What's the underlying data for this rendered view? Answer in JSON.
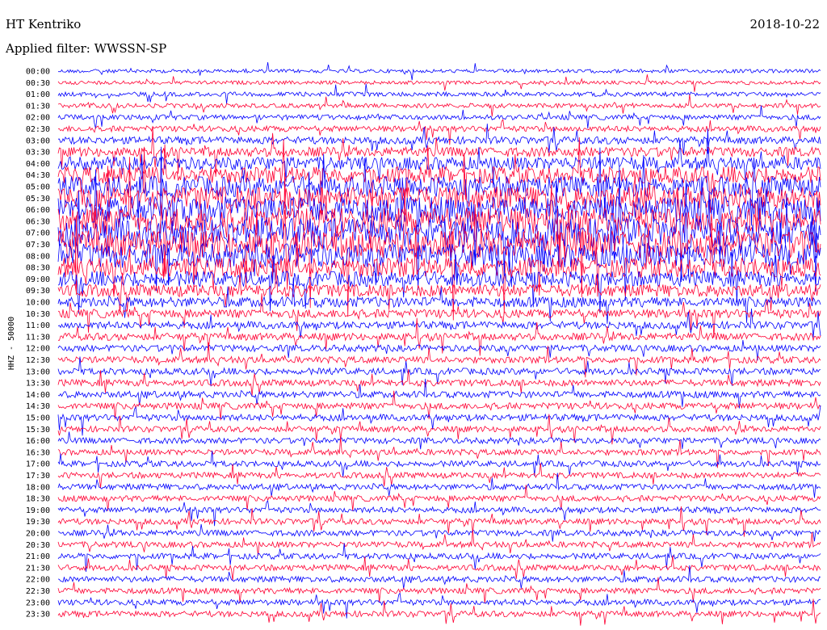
{
  "header": {
    "station": "HT Kentriko",
    "date": "2018-10-22",
    "filter": "Applied filter: WWSSN-SP"
  },
  "chart_data": {
    "type": "line",
    "title": "HT Kentriko",
    "subtitle": "Applied filter: WWSSN-SP",
    "date": "2018-10-22",
    "ylabel": "HHZ - 50000",
    "xlabel": "",
    "row_labels": [
      "00:00",
      "00:30",
      "01:00",
      "01:30",
      "02:00",
      "02:30",
      "03:00",
      "03:30",
      "04:00",
      "04:30",
      "05:00",
      "05:30",
      "06:00",
      "06:30",
      "07:00",
      "07:30",
      "08:00",
      "08:30",
      "09:00",
      "09:30",
      "10:00",
      "10:30",
      "11:00",
      "11:30",
      "12:00",
      "12:30",
      "13:00",
      "13:30",
      "14:00",
      "14:30",
      "15:00",
      "15:30",
      "16:00",
      "16:30",
      "17:00",
      "17:30",
      "18:00",
      "18:30",
      "19:00",
      "19:30",
      "20:00",
      "20:30",
      "21:00",
      "21:30",
      "22:00",
      "22:30",
      "23:00",
      "23:30"
    ],
    "series_colors": [
      "#0000ff",
      "#ff0033"
    ],
    "minutes_per_row": 30,
    "relative_amplitude_by_row": [
      0.5,
      0.5,
      0.6,
      0.6,
      0.7,
      0.8,
      1.0,
      1.3,
      1.8,
      2.3,
      2.8,
      3.2,
      3.6,
      3.8,
      4.0,
      3.8,
      3.3,
      2.7,
      2.1,
      1.7,
      1.4,
      1.2,
      1.0,
      1.0,
      0.9,
      0.9,
      0.9,
      0.9,
      0.9,
      0.9,
      0.9,
      0.8,
      0.8,
      0.8,
      0.8,
      0.8,
      0.8,
      0.8,
      0.8,
      0.8,
      0.8,
      0.8,
      0.8,
      0.8,
      0.8,
      0.8,
      0.8,
      0.8
    ],
    "grid": false,
    "legend": "none"
  }
}
